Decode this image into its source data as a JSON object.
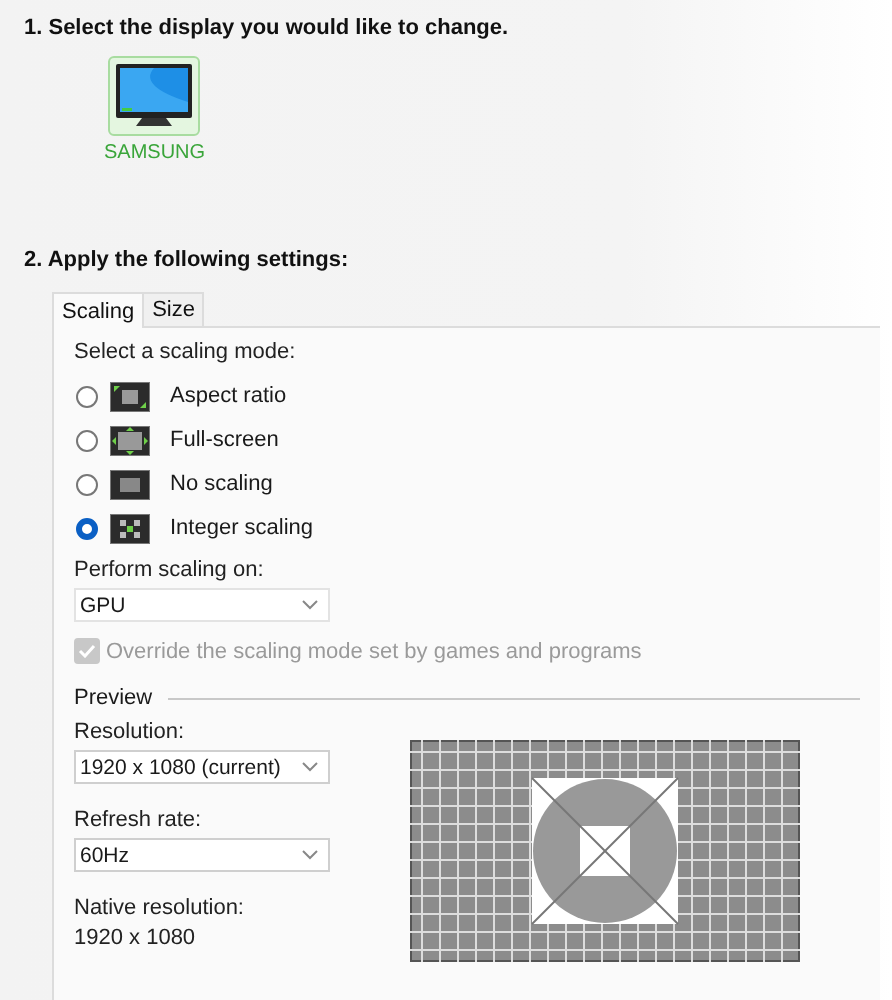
{
  "step1": {
    "heading": "1. Select the display you would like to change.",
    "displays": [
      {
        "label": "SAMSUNG",
        "selected": true
      }
    ]
  },
  "step2": {
    "heading": "2. Apply the following settings:",
    "tabs": [
      {
        "label": "Scaling",
        "selected": true
      },
      {
        "label": "Size",
        "selected": false
      }
    ],
    "mode_label": "Select a scaling mode:",
    "modes": [
      {
        "label": "Aspect ratio",
        "kind": "aspect",
        "selected": false
      },
      {
        "label": "Full-screen",
        "kind": "full",
        "selected": false
      },
      {
        "label": "No scaling",
        "kind": "none",
        "selected": false
      },
      {
        "label": "Integer scaling",
        "kind": "integer",
        "selected": true
      }
    ],
    "perform_label": "Perform scaling on:",
    "perform_value": "GPU",
    "override": {
      "label": "Override the scaling mode set by games and programs",
      "checked": true,
      "disabled": true
    },
    "preview": {
      "title": "Preview",
      "resolution_label": "Resolution:",
      "resolution_value": "1920 x 1080 (current)",
      "refresh_label": "Refresh rate:",
      "refresh_value": "60Hz",
      "native_label": "Native resolution:",
      "native_value": "1920 x 1080"
    }
  }
}
